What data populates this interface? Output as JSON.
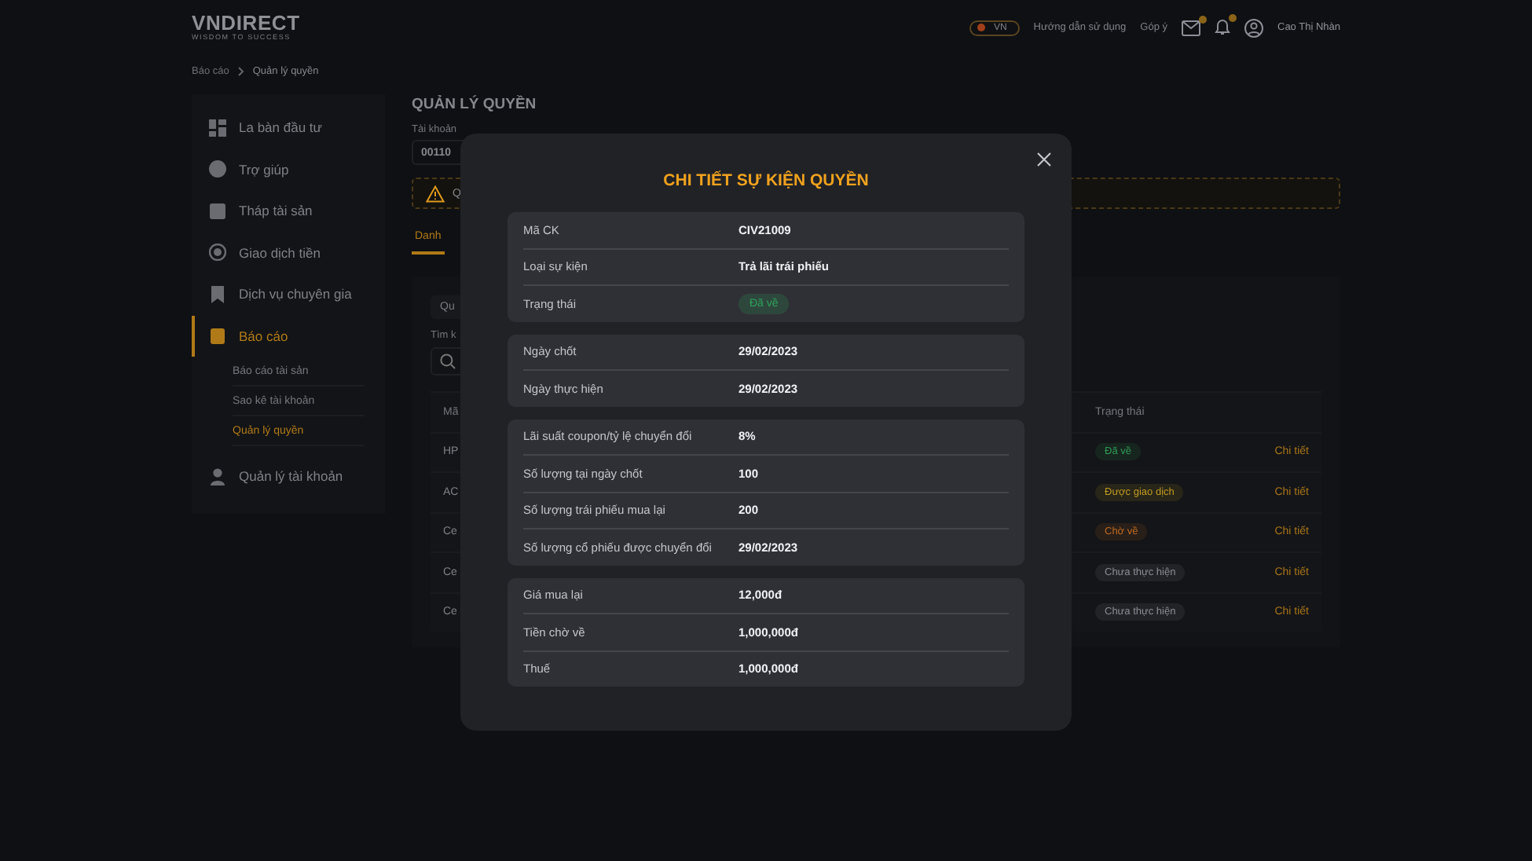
{
  "header": {
    "logo": "VNDIRECT",
    "tagline": "WISDOM TO SUCCESS",
    "language": "VN",
    "links": [
      "Hướng dẫn sử dụng",
      "Góp ý"
    ],
    "user": "Cao Thị Nhàn"
  },
  "breadcrumb": [
    "Báo cáo",
    "Quản lý quyền"
  ],
  "sidebar": {
    "items": [
      {
        "label": "La bàn đầu tư",
        "selected": false
      },
      {
        "label": "Trợ giúp",
        "selected": false
      },
      {
        "label": "Tháp tài sản",
        "selected": false
      },
      {
        "label": "Giao dịch tiền",
        "selected": false
      },
      {
        "label": "Dịch vụ chuyên gia",
        "selected": false
      },
      {
        "label": "Báo cáo",
        "selected": true,
        "children": [
          {
            "label": "Báo cáo tài sản",
            "selected": false
          },
          {
            "label": "Sao kê tài khoản",
            "selected": false
          },
          {
            "label": "Quản lý quyền",
            "selected": true
          }
        ]
      },
      {
        "label": "Quản lý tài khoản",
        "selected": false
      }
    ]
  },
  "main": {
    "title": "QUẢN LÝ QUYỀN",
    "account_label": "Tài khoản",
    "account_value": "00110",
    "warning_text": "Q",
    "tabs": [
      {
        "label": "Danh",
        "selected": true
      }
    ],
    "subtab": "Qu",
    "search_label": "Tìm k",
    "table": {
      "columns": [
        "Mã",
        "Trạng thái"
      ],
      "rows": [
        {
          "column_1": "HP",
          "status": "Đã về",
          "color": "#2f9a55",
          "action": "Chi tiết"
        },
        {
          "column_1": "AC",
          "status": "Được giao dịch",
          "color": "#c09a20",
          "action": "Chi tiết"
        },
        {
          "column_1": "Ce",
          "status": "Chờ về",
          "color": "#c06a20",
          "action": "Chi tiết"
        },
        {
          "column_1": "Ce",
          "status": "Chưa thực hiện",
          "color": "#8a8d96",
          "action": "Chi tiết"
        },
        {
          "column_1": "Ce",
          "status": "Chưa thực hiện",
          "color": "#8a8d96",
          "action": "Chi tiết"
        }
      ]
    }
  },
  "modal": {
    "title": "CHI TIẾT SỰ KIỆN QUYỀN",
    "sections": [
      [
        {
          "label": "Mã CK",
          "value": "CIV21009",
          "kind": "text"
        },
        {
          "label": "Loại sự kiện",
          "value": "Trả lãi trái phiếu",
          "kind": "text"
        },
        {
          "label": "Trạng thái",
          "value": "Đã về",
          "kind": "badge",
          "color": "#2fa35a"
        }
      ],
      [
        {
          "label": "Ngày chốt",
          "value": "29/02/2023",
          "kind": "text"
        },
        {
          "label": "Ngày thực hiện",
          "value": "29/02/2023",
          "kind": "text"
        }
      ],
      [
        {
          "label": "Lãi suất coupon/tỷ lệ chuyển đổi",
          "value": "8%",
          "kind": "text"
        },
        {
          "label": "Số lượng tại ngày chốt",
          "value": "100",
          "kind": "text"
        },
        {
          "label": "Số lượng trái phiếu mua lại",
          "value": "200",
          "kind": "text"
        },
        {
          "label": "Số lượng cổ phiếu được chuyển đổi",
          "value": "29/02/2023",
          "kind": "text"
        }
      ],
      [
        {
          "label": "Giá mua lại",
          "value": "12,000đ",
          "kind": "text"
        },
        {
          "label": "Tiền chờ về",
          "value": "1,000,000đ",
          "kind": "text"
        },
        {
          "label": "Thuế",
          "value": "1,000,000đ",
          "kind": "text"
        }
      ]
    ]
  }
}
